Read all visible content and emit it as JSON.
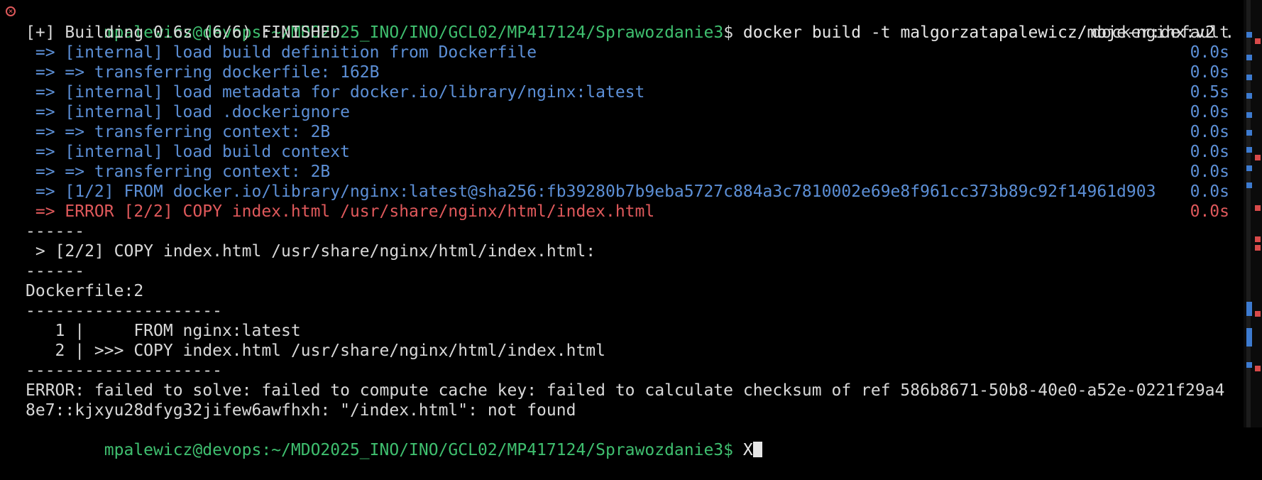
{
  "terminal": {
    "prompt": {
      "user_host": "mpalewicz@devops",
      "sep": ":",
      "path": "~/MDO2025_INO/INO/GCL02/MP417124/Sprawozdanie3",
      "symbol": "$ ",
      "command": "docker build -t malgorzatapalewicz/moje-nginx:v2 ."
    },
    "build_header": "[+] Building 0.6s (6/6) FINISHED",
    "builder": "docker:default",
    "steps": [
      {
        "text": " => [internal] load build definition from Dockerfile",
        "time": "0.0s",
        "status": "ok"
      },
      {
        "text": " => => transferring dockerfile: 162B",
        "time": "0.0s",
        "status": "ok"
      },
      {
        "text": " => [internal] load metadata for docker.io/library/nginx:latest",
        "time": "0.5s",
        "status": "ok"
      },
      {
        "text": " => [internal] load .dockerignore",
        "time": "0.0s",
        "status": "ok"
      },
      {
        "text": " => => transferring context: 2B",
        "time": "0.0s",
        "status": "ok"
      },
      {
        "text": " => [internal] load build context",
        "time": "0.0s",
        "status": "ok"
      },
      {
        "text": " => => transferring context: 2B",
        "time": "0.0s",
        "status": "ok"
      },
      {
        "text": " => [1/2] FROM docker.io/library/nginx:latest@sha256:fb39280b7b9eba5727c884a3c7810002e69e8f961cc373b89c92f14961d903",
        "time": "0.0s",
        "status": "ok"
      },
      {
        "text": " => ERROR [2/2] COPY index.html /usr/share/nginx/html/index.html",
        "time": "0.0s",
        "status": "error"
      }
    ],
    "output": [
      "------",
      " > [2/2] COPY index.html /usr/share/nginx/html/index.html:",
      "------",
      "Dockerfile:2",
      "--------------------",
      "   1 |     FROM nginx:latest",
      "   2 | >>> COPY index.html /usr/share/nginx/html/index.html",
      "--------------------",
      "ERROR: failed to solve: failed to compute cache key: failed to calculate checksum of ref 586b8671-50b8-40e0-a52e-0221f29a4",
      "8e7::kjxyu28dfyg32jifew6awfhxh: \"/index.html\": not found"
    ],
    "last_prompt_visible": "mpalewicz@devops:~/MDO2025_INO/INO/GCL02/MP417124/Sprawozdanie3$ ",
    "last_input": "X"
  },
  "colors": {
    "background": "#000000",
    "prompt": "#3fbf6f",
    "step": "#5c8fd6",
    "error": "#e0595b",
    "text": "#d8d8d8"
  },
  "icons": {
    "error_marker": "error-circle-icon"
  }
}
